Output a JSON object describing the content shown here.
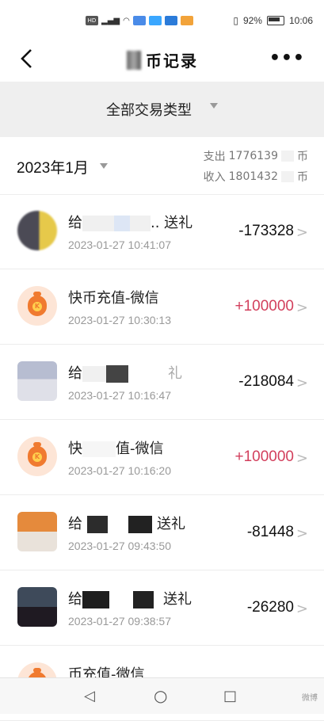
{
  "status_bar": {
    "left_icons": [
      "HD",
      "5G",
      "signal",
      "wifi",
      "app-icons"
    ],
    "battery": "92%",
    "time": "10:06"
  },
  "nav": {
    "title": "币记录",
    "back_icon": "chevron-left-icon",
    "more_icon": "more-dots-icon"
  },
  "filter": {
    "label": "全部交易类型"
  },
  "summary": {
    "month": "2023年1月",
    "expense_label": "支出",
    "expense_value": "1776139",
    "income_label": "收入",
    "income_value": "1801432",
    "unit": "币"
  },
  "transactions": [
    {
      "title_prefix": "给",
      "title_suffix": ".. 送礼",
      "time": "2023-01-27 10:41:07",
      "amount": "-173328",
      "type": "expense",
      "avatar": "photo"
    },
    {
      "title": "快币充值-微信",
      "time": "2023-01-27 10:30:13",
      "amount": "+100000",
      "type": "recharge",
      "avatar": "coin-bag"
    },
    {
      "title_prefix": "给",
      "title_suffix": "礼",
      "time": "2023-01-27 10:16:47",
      "amount": "-218084",
      "type": "expense",
      "avatar": "photo"
    },
    {
      "title_prefix": "快",
      "title_suffix": "值-微信",
      "time": "2023-01-27 10:16:20",
      "amount": "+100000",
      "type": "recharge",
      "avatar": "coin-bag"
    },
    {
      "title_prefix": "给",
      "title_suffix": "送礼",
      "time": "2023-01-27 09:43:50",
      "amount": "-81448",
      "type": "expense",
      "avatar": "photo"
    },
    {
      "title_prefix": "给",
      "title_suffix": "送礼",
      "time": "2023-01-27 09:38:57",
      "amount": "-26280",
      "type": "expense",
      "avatar": "photo"
    },
    {
      "title_prefix": "",
      "title_suffix": "币充值-微信",
      "time": "",
      "amount": "",
      "type": "recharge",
      "avatar": "coin-bag"
    }
  ],
  "colors": {
    "positive_amount": "#d23f5c",
    "negative_amount": "#111111",
    "filter_bg": "#efefef",
    "coin_bag": "#f07a2f"
  },
  "system_nav": {
    "back": "◁",
    "home": "○",
    "recent": "□"
  },
  "watermark": "微博"
}
